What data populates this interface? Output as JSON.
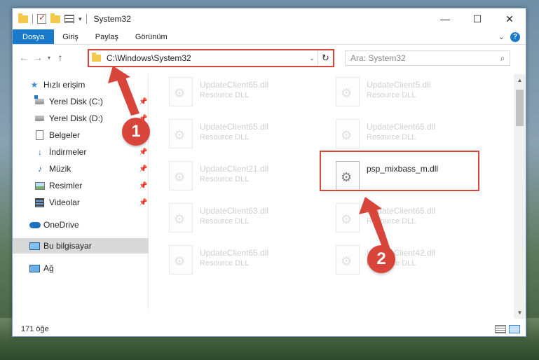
{
  "window": {
    "title": "System32",
    "controls": {
      "minimize": "—",
      "maximize": "☐",
      "close": "✕"
    }
  },
  "ribbon": {
    "tabs": [
      "Dosya",
      "Giriş",
      "Paylaş",
      "Görünüm"
    ],
    "help": "?"
  },
  "address": {
    "path": "C:\\Windows\\System32",
    "search_placeholder": "Ara: System32"
  },
  "sidebar": {
    "items": [
      {
        "label": "Hızlı erişim",
        "icon": "star-icon",
        "pinned": false
      },
      {
        "label": "Yerel Disk (C:)",
        "icon": "drive-c-icon",
        "pinned": true
      },
      {
        "label": "Yerel Disk (D:)",
        "icon": "drive-icon",
        "pinned": true
      },
      {
        "label": "Belgeler",
        "icon": "documents-icon",
        "pinned": true
      },
      {
        "label": "İndirmeler",
        "icon": "downloads-icon",
        "pinned": true
      },
      {
        "label": "Müzik",
        "icon": "music-icon",
        "pinned": true
      },
      {
        "label": "Resimler",
        "icon": "pictures-icon",
        "pinned": true
      },
      {
        "label": "Videolar",
        "icon": "videos-icon",
        "pinned": true
      },
      {
        "label": "OneDrive",
        "icon": "onedrive-icon",
        "pinned": false
      },
      {
        "label": "Bu bilgisayar",
        "icon": "this-pc-icon",
        "pinned": false,
        "selected": true
      },
      {
        "label": "Ağ",
        "icon": "network-icon",
        "pinned": false
      }
    ]
  },
  "files": [
    {
      "name": "UpdateClient65.dll",
      "type": "Resource DLL"
    },
    {
      "name": "UpdateClient5.dll",
      "type": "Resource DLL"
    },
    {
      "name": "UpdateClient65.dll",
      "type": "Resource DLL"
    },
    {
      "name": "UpdateClient65.dll",
      "type": "Resource DLL"
    },
    {
      "name": "UpdateClient21.dll",
      "type": "Resource DLL"
    },
    {
      "name": "psp_mixbass_m.dll",
      "type": "",
      "highlighted": true
    },
    {
      "name": "UpdateClient63.dll",
      "type": "Resource DLL"
    },
    {
      "name": "UpdateClient65.dll",
      "type": "Resource DLL"
    },
    {
      "name": "UpdateClient65.dll",
      "type": "Resource DLL"
    },
    {
      "name": "UpdateClient42.dll",
      "type": "Resource DLL"
    }
  ],
  "status": {
    "item_count": "171 öğe"
  },
  "annotations": {
    "step1": "1",
    "step2": "2",
    "color": "#d8453a"
  }
}
